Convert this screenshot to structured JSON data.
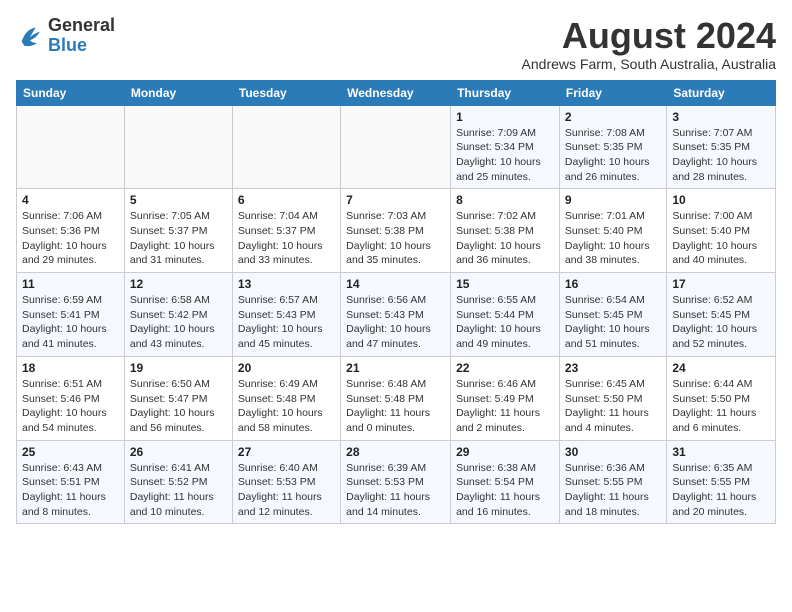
{
  "logo": {
    "general": "General",
    "blue": "Blue"
  },
  "title": {
    "month_year": "August 2024",
    "location": "Andrews Farm, South Australia, Australia"
  },
  "headers": [
    "Sunday",
    "Monday",
    "Tuesday",
    "Wednesday",
    "Thursday",
    "Friday",
    "Saturday"
  ],
  "weeks": [
    [
      {
        "day": "",
        "info": ""
      },
      {
        "day": "",
        "info": ""
      },
      {
        "day": "",
        "info": ""
      },
      {
        "day": "",
        "info": ""
      },
      {
        "day": "1",
        "info": "Sunrise: 7:09 AM\nSunset: 5:34 PM\nDaylight: 10 hours\nand 25 minutes."
      },
      {
        "day": "2",
        "info": "Sunrise: 7:08 AM\nSunset: 5:35 PM\nDaylight: 10 hours\nand 26 minutes."
      },
      {
        "day": "3",
        "info": "Sunrise: 7:07 AM\nSunset: 5:35 PM\nDaylight: 10 hours\nand 28 minutes."
      }
    ],
    [
      {
        "day": "4",
        "info": "Sunrise: 7:06 AM\nSunset: 5:36 PM\nDaylight: 10 hours\nand 29 minutes."
      },
      {
        "day": "5",
        "info": "Sunrise: 7:05 AM\nSunset: 5:37 PM\nDaylight: 10 hours\nand 31 minutes."
      },
      {
        "day": "6",
        "info": "Sunrise: 7:04 AM\nSunset: 5:37 PM\nDaylight: 10 hours\nand 33 minutes."
      },
      {
        "day": "7",
        "info": "Sunrise: 7:03 AM\nSunset: 5:38 PM\nDaylight: 10 hours\nand 35 minutes."
      },
      {
        "day": "8",
        "info": "Sunrise: 7:02 AM\nSunset: 5:38 PM\nDaylight: 10 hours\nand 36 minutes."
      },
      {
        "day": "9",
        "info": "Sunrise: 7:01 AM\nSunset: 5:40 PM\nDaylight: 10 hours\nand 38 minutes."
      },
      {
        "day": "10",
        "info": "Sunrise: 7:00 AM\nSunset: 5:40 PM\nDaylight: 10 hours\nand 40 minutes."
      }
    ],
    [
      {
        "day": "11",
        "info": "Sunrise: 6:59 AM\nSunset: 5:41 PM\nDaylight: 10 hours\nand 41 minutes."
      },
      {
        "day": "12",
        "info": "Sunrise: 6:58 AM\nSunset: 5:42 PM\nDaylight: 10 hours\nand 43 minutes."
      },
      {
        "day": "13",
        "info": "Sunrise: 6:57 AM\nSunset: 5:43 PM\nDaylight: 10 hours\nand 45 minutes."
      },
      {
        "day": "14",
        "info": "Sunrise: 6:56 AM\nSunset: 5:43 PM\nDaylight: 10 hours\nand 47 minutes."
      },
      {
        "day": "15",
        "info": "Sunrise: 6:55 AM\nSunset: 5:44 PM\nDaylight: 10 hours\nand 49 minutes."
      },
      {
        "day": "16",
        "info": "Sunrise: 6:54 AM\nSunset: 5:45 PM\nDaylight: 10 hours\nand 51 minutes."
      },
      {
        "day": "17",
        "info": "Sunrise: 6:52 AM\nSunset: 5:45 PM\nDaylight: 10 hours\nand 52 minutes."
      }
    ],
    [
      {
        "day": "18",
        "info": "Sunrise: 6:51 AM\nSunset: 5:46 PM\nDaylight: 10 hours\nand 54 minutes."
      },
      {
        "day": "19",
        "info": "Sunrise: 6:50 AM\nSunset: 5:47 PM\nDaylight: 10 hours\nand 56 minutes."
      },
      {
        "day": "20",
        "info": "Sunrise: 6:49 AM\nSunset: 5:48 PM\nDaylight: 10 hours\nand 58 minutes."
      },
      {
        "day": "21",
        "info": "Sunrise: 6:48 AM\nSunset: 5:48 PM\nDaylight: 11 hours\nand 0 minutes."
      },
      {
        "day": "22",
        "info": "Sunrise: 6:46 AM\nSunset: 5:49 PM\nDaylight: 11 hours\nand 2 minutes."
      },
      {
        "day": "23",
        "info": "Sunrise: 6:45 AM\nSunset: 5:50 PM\nDaylight: 11 hours\nand 4 minutes."
      },
      {
        "day": "24",
        "info": "Sunrise: 6:44 AM\nSunset: 5:50 PM\nDaylight: 11 hours\nand 6 minutes."
      }
    ],
    [
      {
        "day": "25",
        "info": "Sunrise: 6:43 AM\nSunset: 5:51 PM\nDaylight: 11 hours\nand 8 minutes."
      },
      {
        "day": "26",
        "info": "Sunrise: 6:41 AM\nSunset: 5:52 PM\nDaylight: 11 hours\nand 10 minutes."
      },
      {
        "day": "27",
        "info": "Sunrise: 6:40 AM\nSunset: 5:53 PM\nDaylight: 11 hours\nand 12 minutes."
      },
      {
        "day": "28",
        "info": "Sunrise: 6:39 AM\nSunset: 5:53 PM\nDaylight: 11 hours\nand 14 minutes."
      },
      {
        "day": "29",
        "info": "Sunrise: 6:38 AM\nSunset: 5:54 PM\nDaylight: 11 hours\nand 16 minutes."
      },
      {
        "day": "30",
        "info": "Sunrise: 6:36 AM\nSunset: 5:55 PM\nDaylight: 11 hours\nand 18 minutes."
      },
      {
        "day": "31",
        "info": "Sunrise: 6:35 AM\nSunset: 5:55 PM\nDaylight: 11 hours\nand 20 minutes."
      }
    ]
  ]
}
